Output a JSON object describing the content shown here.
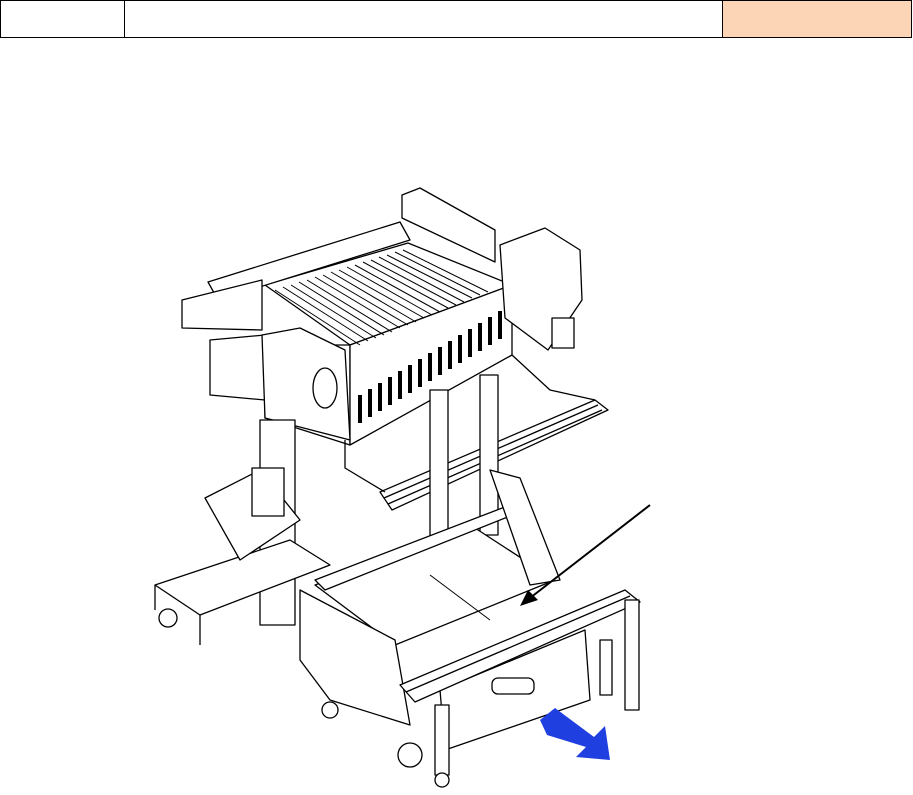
{
  "header": {
    "cells": [
      "",
      "",
      ""
    ],
    "highlight_color": "#fbd5b5"
  },
  "figure": {
    "icons": [
      "machine-illustration",
      "pointer-arrow",
      "pull-direction-arrow"
    ],
    "accent_color": "#1f3fe0"
  }
}
